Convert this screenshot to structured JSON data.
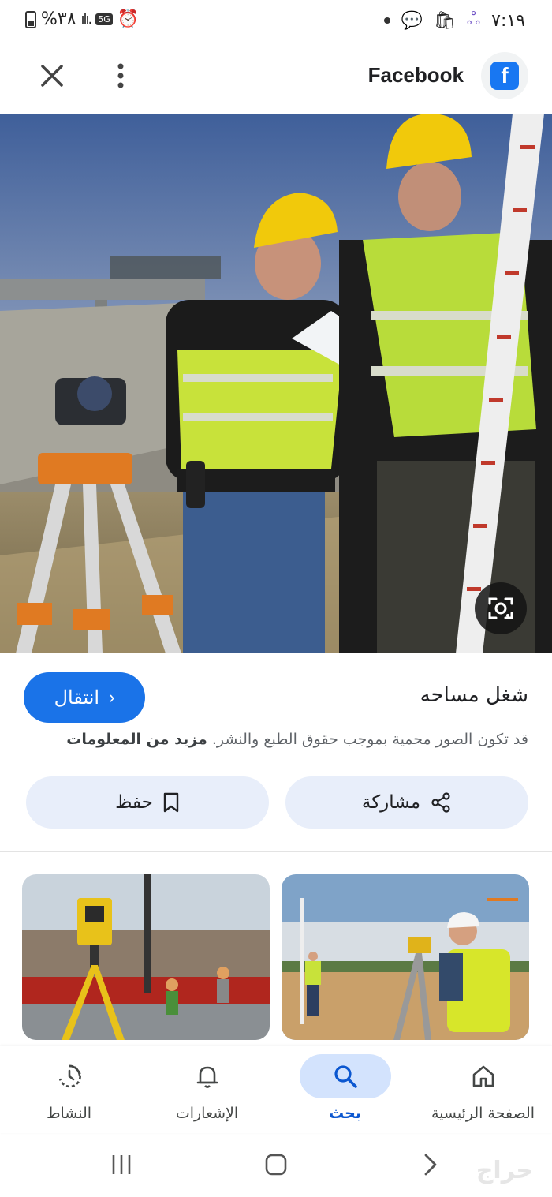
{
  "status_bar": {
    "battery": "%٣٨",
    "network": "5G",
    "time": "٧:١٩"
  },
  "header": {
    "source_name": "Facebook",
    "logo_letter": "f",
    "brand_color": "#1877f2"
  },
  "result": {
    "title": "شغل مساحه",
    "visit_label": "انتقال",
    "copyright_text": "قد تكون الصور محمية بموجب حقوق الطبع والنشر.",
    "more_info_link": "مزيد من المعلومات"
  },
  "actions": {
    "share_label": "مشاركة",
    "save_label": "حفظ"
  },
  "bottom_nav": {
    "items": [
      {
        "label": "الصفحة الرئيسية",
        "icon": "home-icon"
      },
      {
        "label": "بحث",
        "icon": "search-icon",
        "active": true
      },
      {
        "label": "الإشعارات",
        "icon": "bell-icon"
      },
      {
        "label": "النشاط",
        "icon": "activity-icon"
      }
    ]
  },
  "watermark": "حراج",
  "accent_color": "#1a73e8"
}
